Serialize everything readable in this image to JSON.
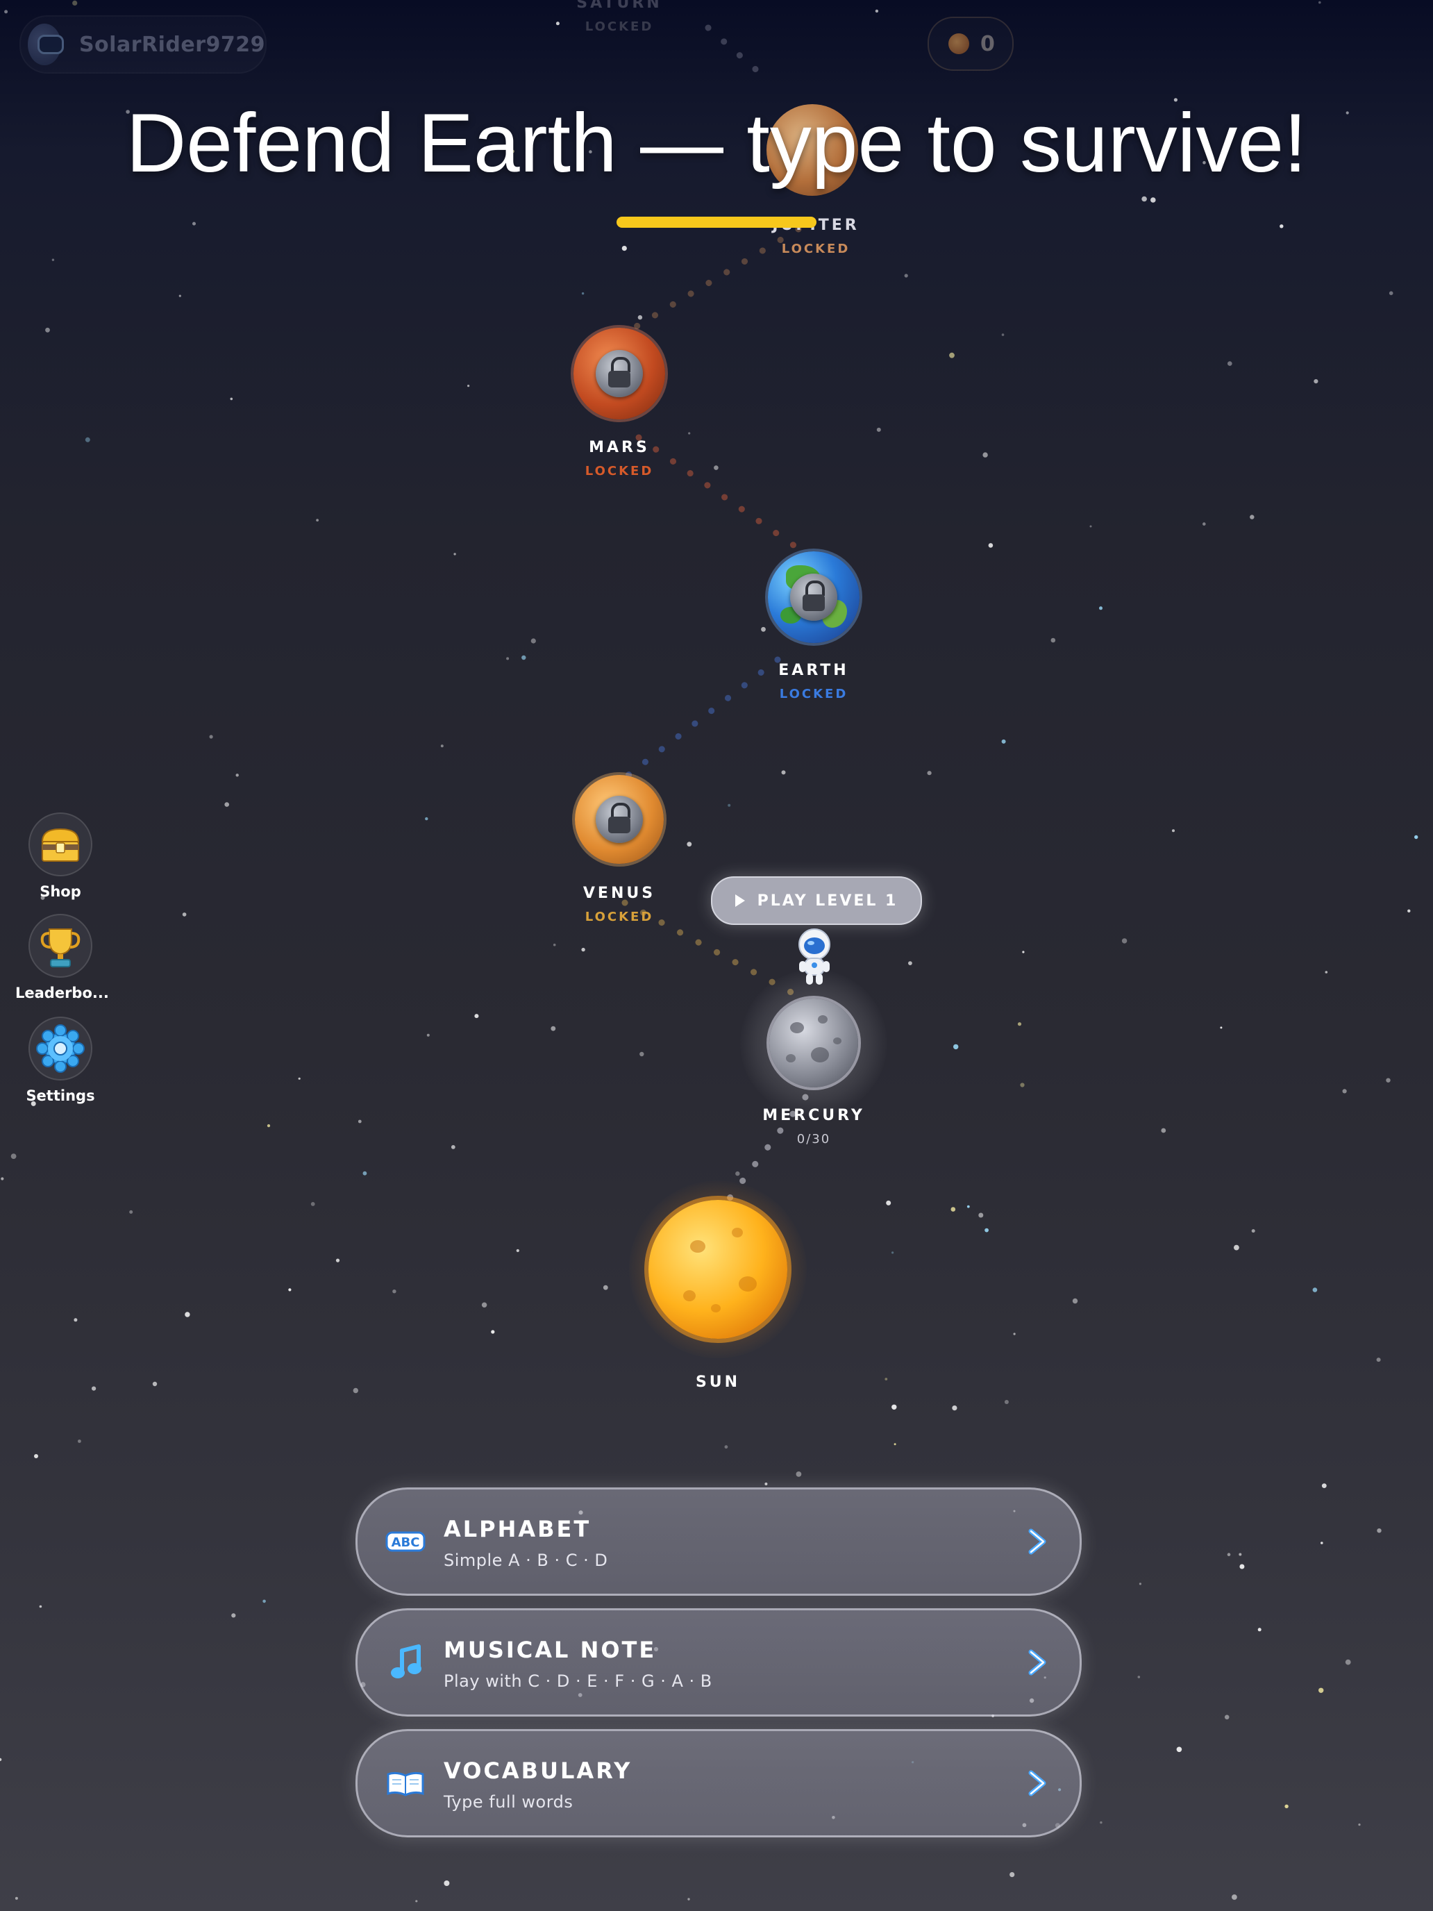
{
  "user": {
    "name": "SolarRider9729",
    "avatar_icon": "astronaut-helmet-icon"
  },
  "coins": {
    "count": "0",
    "icon": "coin-planet-icon"
  },
  "title": "Defend Earth — type to survive!",
  "accent_color": "#f7c81c",
  "planets": [
    {
      "id": "saturn",
      "name": "SATURN",
      "status": "LOCKED",
      "locked": true,
      "status_color": "#8a8a9a"
    },
    {
      "id": "jupiter",
      "name": "JUPITER",
      "status": "LOCKED",
      "locked": true,
      "status_color": "#c88a5a"
    },
    {
      "id": "mars",
      "name": "MARS",
      "status": "LOCKED",
      "locked": true,
      "status_color": "#d65a2a"
    },
    {
      "id": "earth",
      "name": "EARTH",
      "status": "LOCKED",
      "locked": true,
      "status_color": "#3a7be0"
    },
    {
      "id": "venus",
      "name": "VENUS",
      "status": "LOCKED",
      "locked": true,
      "status_color": "#d8a13a"
    },
    {
      "id": "mercury",
      "name": "MERCURY",
      "status": "0/30",
      "locked": false,
      "status_color": "#c9c9d2"
    },
    {
      "id": "sun",
      "name": "SUN",
      "status": "",
      "locked": false,
      "status_color": "#ffffff"
    }
  ],
  "play_button": {
    "label": "PLAY LEVEL 1"
  },
  "side_menu": [
    {
      "id": "shop",
      "label": "Shop",
      "icon": "treasure-chest-icon"
    },
    {
      "id": "leaderboard",
      "label": "Leaderbo...",
      "icon": "trophy-icon"
    },
    {
      "id": "settings",
      "label": "Settings",
      "icon": "gear-icon"
    }
  ],
  "modes": [
    {
      "id": "alphabet",
      "title": "ALPHABET",
      "subtitle": "Simple A · B · C · D",
      "icon": "abc-icon"
    },
    {
      "id": "musical-note",
      "title": "MUSICAL NOTE",
      "subtitle": "Play with C · D · E · F · G · A · B",
      "icon": "music-note-icon"
    },
    {
      "id": "vocabulary",
      "title": "VOCABULARY",
      "subtitle": "Type full words",
      "icon": "book-icon"
    }
  ]
}
